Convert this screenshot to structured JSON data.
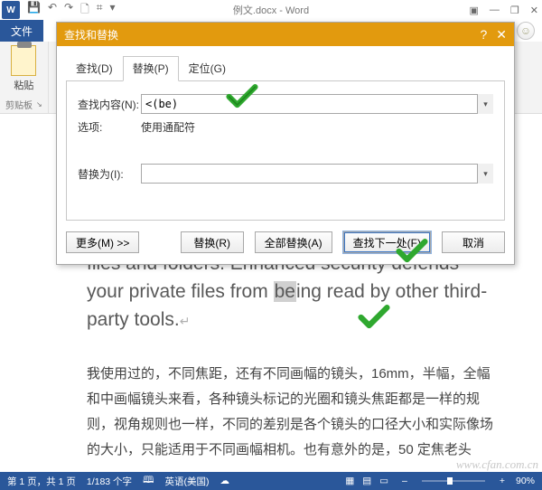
{
  "title_bar": {
    "app_badge": "W",
    "document_title": "例文.docx - Word",
    "qat": {
      "save": "💾",
      "undo": "↶",
      "redo": "↷",
      "new": "🗋",
      "table": "⌗",
      "dropdown": "▾"
    },
    "window": {
      "rib_opts": "▣",
      "min": "—",
      "restore": "❐",
      "close": "✕"
    }
  },
  "ribbon": {
    "file_tab": "文件",
    "paste_label": "粘贴",
    "clipboard_group": "剪贴板",
    "smiley": "☺"
  },
  "dialog": {
    "title": "查找和替换",
    "help_btn": "?",
    "close_btn": "✕",
    "tabs": {
      "find": "查找(D)",
      "replace": "替换(P)",
      "goto": "定位(G)"
    },
    "labels": {
      "find_what": "查找内容(N):",
      "options": "选项:",
      "options_value": "使用通配符",
      "replace_with": "替换为(I):"
    },
    "fields": {
      "find_value": "<(be)",
      "replace_value": ""
    },
    "buttons": {
      "more": "更多(M) >>",
      "replace": "替换(R)",
      "replace_all": "全部替换(A)",
      "find_next": "查找下一处(F)",
      "cancel": "取消"
    }
  },
  "document": {
    "para1_pre": "files and folders. Enhanced security defends your private files from ",
    "para1_hl": "be",
    "para1_post": "ing read by other third-party tools.",
    "para2": "我使用过的，不同焦距，还有不同画幅的镜头，16mm，半幅，全幅和中画幅镜头来看，各种镜头标记的光圈和镜头焦距都是一样的规则，视角规则也一样，不同的差别是各个镜头的口径大小和实际像场的大小，只能适用于不同画幅相机。也有意外的是，50 定焦老头"
  },
  "status": {
    "page": "第 1 页，共 1 页",
    "words": "1/183 个字",
    "proof_icon": "🕮",
    "lang": "英语(美国)",
    "ime_icon": "☁",
    "views": {
      "read": "▦",
      "print": "▤",
      "web": "▭"
    },
    "zoom_minus": "–",
    "zoom_plus": "+",
    "zoom_value": "90%"
  },
  "watermark": "www.cfan.com.cn"
}
